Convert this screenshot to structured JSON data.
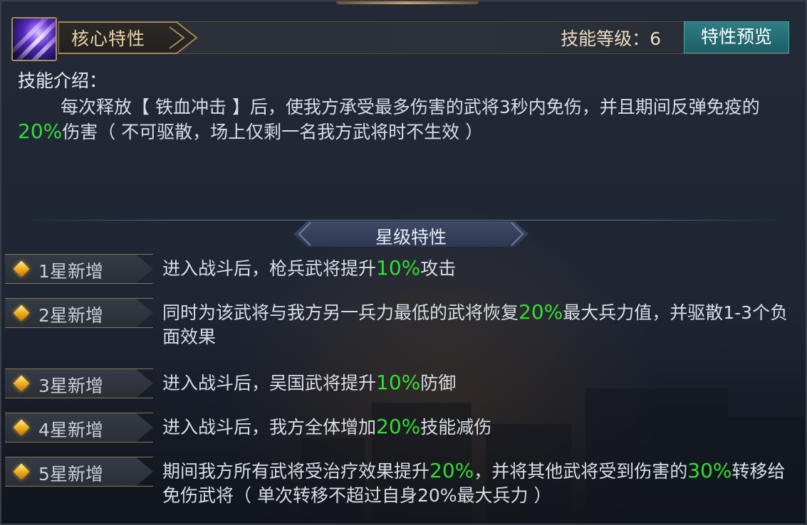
{
  "header": {
    "title": "核心特性",
    "level_label": "技能等级：6",
    "preview_button": "特性预览"
  },
  "intro": {
    "label": "技能介绍：",
    "text_before": "每次释放【 铁血冲击 】后，使我方承受最多伤害的武将3秒内免伤，并且期间反弹免疫的",
    "highlight": "20%",
    "text_after": "伤害（ 不可驱散，场上仅剩一名我方武将时不生效 ）"
  },
  "star_section": {
    "title": "星级特性",
    "rows": [
      {
        "label": "1星新增",
        "before": "进入战斗后，枪兵武将提升",
        "highlight": "10%",
        "after": "攻击",
        "highlight2": "",
        "after2": ""
      },
      {
        "label": "2星新增",
        "before": "同时为该武将与我方另一兵力最低的武将恢复",
        "highlight": "20%",
        "after": "最大兵力值，并驱散1-3个负面效果",
        "highlight2": "",
        "after2": ""
      },
      {
        "label": "3星新增",
        "before": "进入战斗后，吴国武将提升",
        "highlight": "10%",
        "after": "防御",
        "highlight2": "",
        "after2": ""
      },
      {
        "label": "4星新增",
        "before": "进入战斗后，我方全体增加",
        "highlight": "20%",
        "after": "技能减伤",
        "highlight2": "",
        "after2": ""
      },
      {
        "label": "5星新增",
        "before": "期间我方所有武将受治疗效果提升",
        "highlight": "20%",
        "after": "，并将其他武将受到伤害的",
        "highlight2": "30%",
        "after2": "转移给免伤武将（ 单次转移不超过自身20%最大兵力 ）"
      }
    ]
  },
  "colors": {
    "highlight": "#33dd33",
    "preview_button": "#1c5d64",
    "title_text": "#e9d2a6"
  },
  "icons": {
    "skill_icon": "purple-slash-skill-icon",
    "star_bullet": "gold-diamond-icon"
  }
}
